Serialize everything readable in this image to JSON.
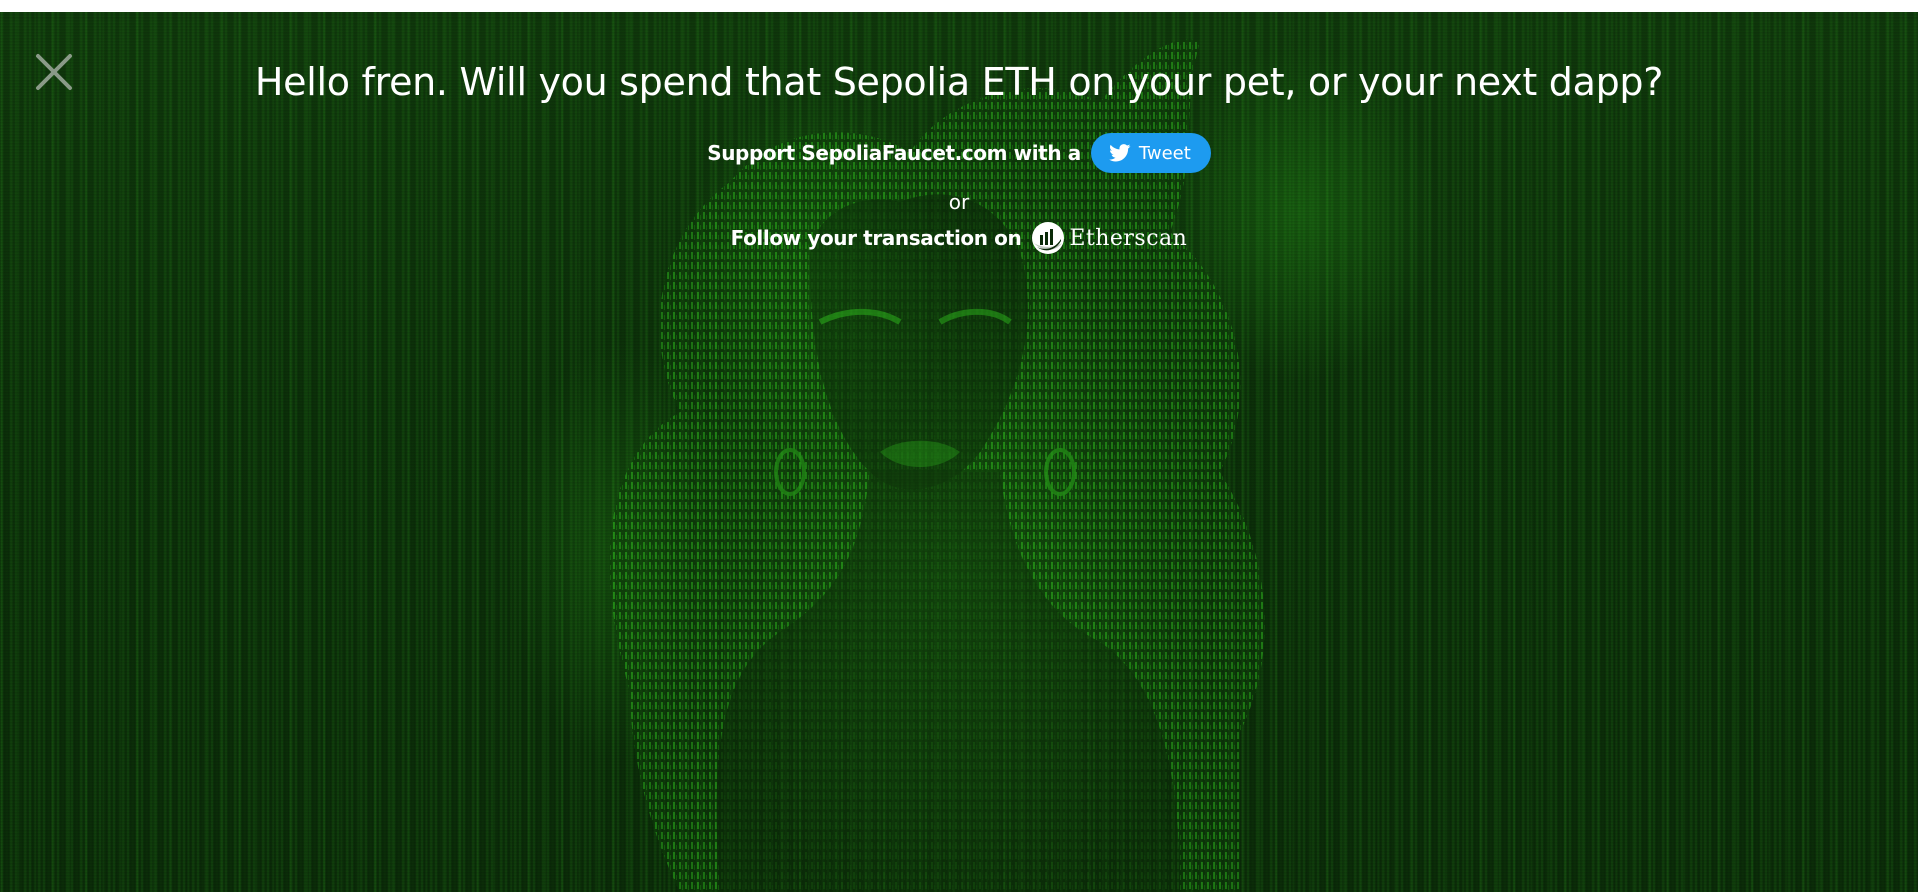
{
  "modal": {
    "headline": "Hello fren. Will you spend that Sepolia ETH on your pet, or your next dapp?",
    "support_text": "Support SepoliaFaucet.com with a",
    "tweet_label": "Tweet",
    "or_text": "or",
    "follow_text": "Follow your transaction on",
    "etherscan_label": "Etherscan"
  },
  "icons": {
    "close": "close-icon",
    "twitter": "twitter-bird-icon",
    "etherscan": "etherscan-logo-icon"
  },
  "colors": {
    "background": "#0a2a08",
    "matrix_green": "#22a315",
    "tweet_button": "#1d9bf0",
    "text": "#ffffff",
    "close_icon": "#8a9a88"
  }
}
